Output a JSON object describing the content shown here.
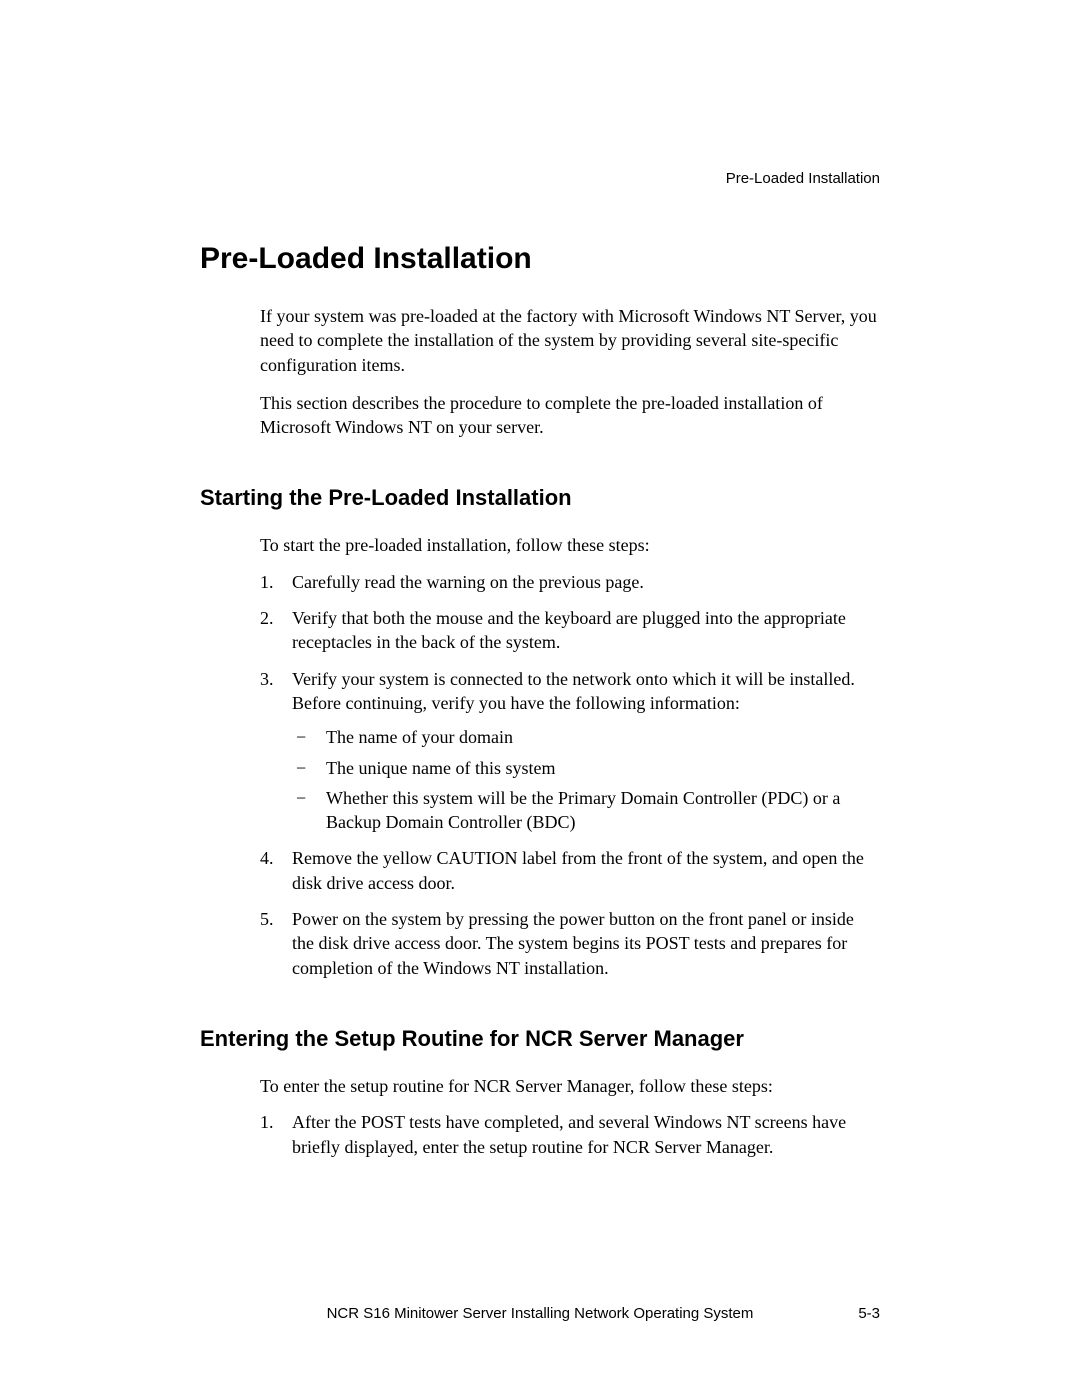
{
  "header": {
    "label": "Pre-Loaded Installation"
  },
  "main": {
    "heading": "Pre-Loaded Installation",
    "intro": [
      "If your system was pre-loaded at the factory with Microsoft Windows NT Server, you need to complete the installation of the system by providing several site-specific configuration items.",
      "This section describes the procedure to complete the pre-loaded installation of Microsoft Windows NT on your server."
    ],
    "sections": [
      {
        "heading": "Starting the Pre-Loaded Installation",
        "lead": "To start the pre-loaded installation, follow these steps:",
        "items": [
          {
            "num": "1.",
            "text": "Carefully read the warning on the previous page."
          },
          {
            "num": "2.",
            "text": "Verify that both the mouse and the keyboard are plugged into the appropriate receptacles in the back of the system."
          },
          {
            "num": "3.",
            "text": "Verify your system is connected to the network onto which it will be installed. Before continuing, verify you have the following information:",
            "sub": [
              "The name of your domain",
              "The unique name of this system",
              "Whether this system will be the Primary Domain Controller (PDC) or a Backup Domain Controller (BDC)"
            ]
          },
          {
            "num": "4.",
            "text": "Remove the yellow CAUTION label from the front of the system, and open the disk drive access door."
          },
          {
            "num": "5.",
            "text": "Power on the system by pressing the power button on the front panel or inside the disk drive access door. The system begins its POST tests and prepares for completion of the Windows NT installation."
          }
        ]
      },
      {
        "heading": "Entering the Setup Routine for NCR Server Manager",
        "lead": "To enter the setup routine for NCR Server Manager, follow these steps:",
        "items": [
          {
            "num": "1.",
            "text": "After the POST tests have completed, and several Windows NT screens have briefly displayed, enter the setup routine for NCR Server Manager."
          }
        ]
      }
    ]
  },
  "footer": {
    "title": "NCR S16 Minitower Server Installing Network Operating System",
    "page": "5-3"
  },
  "dash": "−"
}
